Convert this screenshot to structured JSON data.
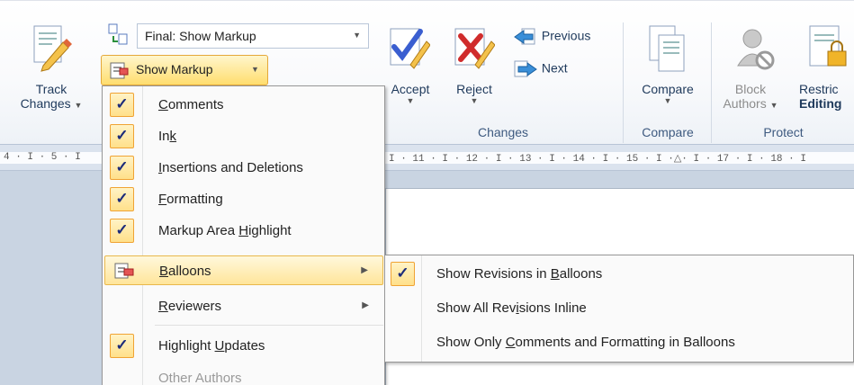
{
  "ribbon": {
    "track_changes": {
      "line1": "Track",
      "line2": "Changes"
    },
    "display_for_review": "Final: Show Markup",
    "show_markup": "Show Markup",
    "accept": "Accept",
    "reject": "Reject",
    "previous": "Previous",
    "next": "Next",
    "compare": "Compare",
    "block_authors": {
      "line1": "Block",
      "line2": "Authors"
    },
    "restrict_editing": {
      "line1": "Restric",
      "line2": "Editing"
    },
    "groups": {
      "changes": "Changes",
      "compare": "Compare",
      "protect": "Protect"
    }
  },
  "ruler": {
    "left": "4 · I · 5 · I",
    "right": "I · 11 · I · 12 · I · 13 · I · 14 · I · 15 · I ·△· I · 17 · I · 18 · I"
  },
  "show_markup_menu": {
    "items": [
      {
        "pre": "",
        "u": "C",
        "post": "omments",
        "checked": true
      },
      {
        "pre": "In",
        "u": "k",
        "post": "",
        "checked": true
      },
      {
        "pre": "",
        "u": "I",
        "post": "nsertions and Deletions",
        "checked": true
      },
      {
        "pre": "",
        "u": "F",
        "post": "ormatting",
        "checked": true
      },
      {
        "pre": "Markup Area ",
        "u": "H",
        "post": "ighlight",
        "checked": true
      },
      {
        "pre": "",
        "u": "B",
        "post": "alloons",
        "checked": false
      },
      {
        "pre": "",
        "u": "R",
        "post": "eviewers",
        "checked": false
      },
      {
        "pre": "Highlight ",
        "u": "U",
        "post": "pdates",
        "checked": true
      },
      {
        "pre": "Other Authors",
        "u": "",
        "post": "",
        "checked": false
      }
    ]
  },
  "balloons_menu": {
    "items": [
      {
        "pre": "Show Revisions in ",
        "u": "B",
        "post": "alloons",
        "checked": true
      },
      {
        "pre": "Show All Rev",
        "u": "i",
        "post": "sions Inline",
        "checked": false
      },
      {
        "pre": "Show Only ",
        "u": "C",
        "post": "omments and Formatting in Balloons",
        "checked": false
      }
    ]
  },
  "colors": {
    "highlight": "#ffe59a",
    "check_border": "#f0a334",
    "ribbon_text": "#1e395b"
  }
}
